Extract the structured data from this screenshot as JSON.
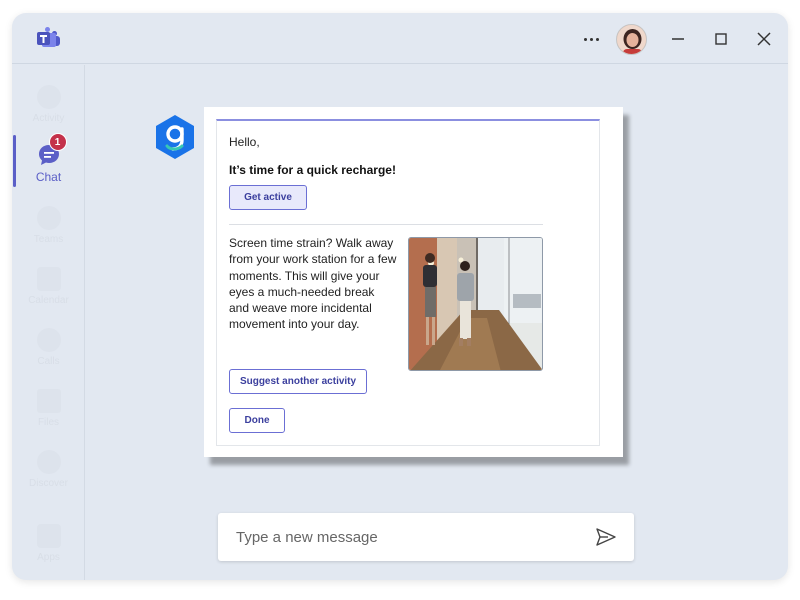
{
  "window": {
    "app": "Microsoft Teams",
    "more_icon": "more-horizontal-icon",
    "min_icon": "minimize-icon",
    "max_icon": "maximize-icon",
    "close_icon": "close-icon"
  },
  "rail": {
    "items": [
      {
        "label": "Activity",
        "icon": "bell-icon"
      },
      {
        "label": "Chat",
        "icon": "chat-icon",
        "badge": "1",
        "active": true
      },
      {
        "label": "Teams",
        "icon": "teams-icon"
      },
      {
        "label": "Calendar",
        "icon": "calendar-icon"
      },
      {
        "label": "Calls",
        "icon": "phone-icon"
      },
      {
        "label": "Files",
        "icon": "file-icon"
      },
      {
        "label": "Discover",
        "icon": "compass-icon"
      },
      {
        "label": "Apps",
        "icon": "apps-icon"
      }
    ]
  },
  "card": {
    "greeting": "Hello,",
    "headline": "It’s time for a quick recharge!",
    "primary_button": "Get active",
    "body": "Screen time strain? Walk away from your work station for a few moments. This will give your eyes a much-needed break and weave more incidental movement into your day.",
    "suggest_button": "Suggest another activity",
    "done_button": "Done"
  },
  "compose": {
    "placeholder": "Type a new message",
    "send_icon": "send-icon"
  },
  "colors": {
    "accent": "#5b5fc7",
    "badge": "#c4314b",
    "bot": "#1a73e8"
  }
}
